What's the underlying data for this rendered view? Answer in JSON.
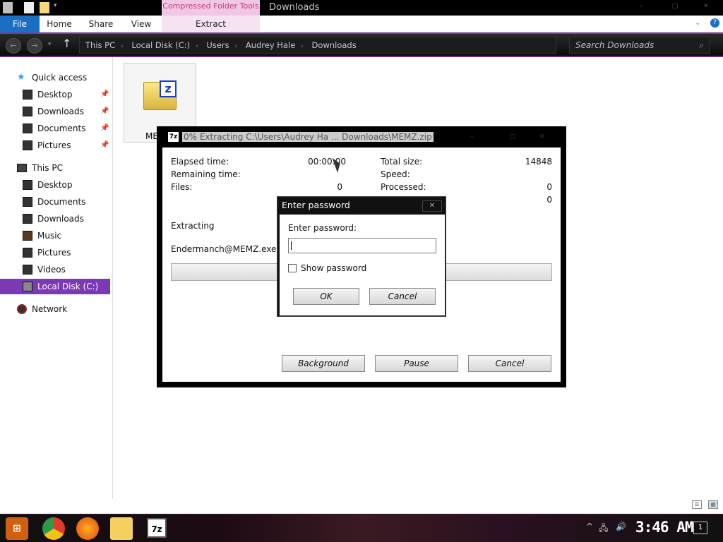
{
  "titlebar": {
    "context_tab": "Compressed Folder Tools",
    "title": "Downloads",
    "controls": [
      "–",
      "□",
      "✕"
    ]
  },
  "ribbon": {
    "tabs": [
      "File",
      "Home",
      "Share",
      "View",
      "Extract"
    ]
  },
  "address": {
    "crumbs": [
      "This PC",
      "Local Disk (C:)",
      "Users",
      "Audrey Hale",
      "Downloads"
    ],
    "search_placeholder": "Search Downloads"
  },
  "navpane": {
    "quick_access": "Quick access",
    "quick_items": [
      "Desktop",
      "Downloads",
      "Documents",
      "Pictures"
    ],
    "this_pc": "This PC",
    "pc_items": [
      "Desktop",
      "Documents",
      "Downloads",
      "Music",
      "Pictures",
      "Videos",
      "Local Disk (C:)"
    ],
    "network": "Network"
  },
  "file": {
    "name": "MEM"
  },
  "progress_window": {
    "logo": "7z",
    "title": "0% Extracting C:\\Users\\Audrey Ha ... Downloads\\MEMZ.zip",
    "elapsed_label": "Elapsed time:",
    "elapsed_value": "00:00:00",
    "remaining_label": "Remaining time:",
    "files_label": "Files:",
    "files_value": "0",
    "total_size_label": "Total size:",
    "total_size_value": "14848",
    "speed_label": "Speed:",
    "processed_label": "Processed:",
    "processed_value": "0",
    "extra_value": "0",
    "extracting_label": "Extracting",
    "current_file": "Endermanch@MEMZ.exe",
    "background_btn": "Background",
    "pause_btn": "Pause",
    "cancel_btn": "Cancel"
  },
  "password_dialog": {
    "title": "Enter password",
    "close": "✕",
    "prompt": "Enter password:",
    "value": "",
    "show_password": "Show password",
    "ok_btn": "OK",
    "cancel_btn": "Cancel"
  },
  "taskbar": {
    "clock": "3:46 AM",
    "notifications": "1",
    "app_7z": "7z"
  }
}
